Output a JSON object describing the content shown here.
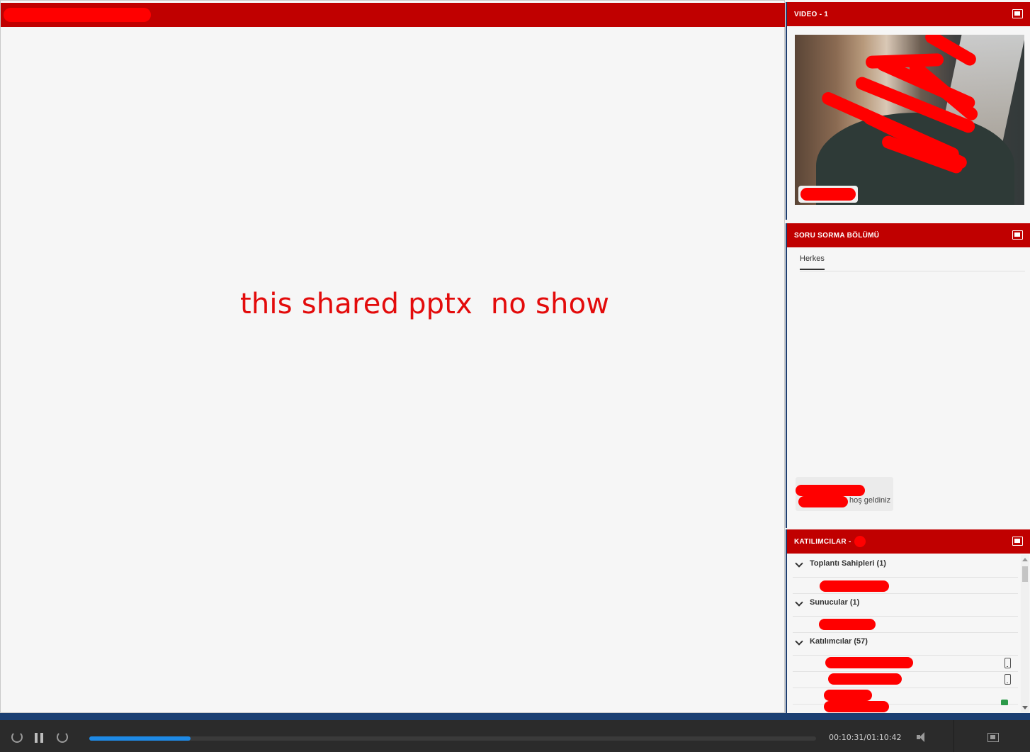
{
  "share_pod": {
    "message": "this shared pptx  no show"
  },
  "video_pod": {
    "title": "VIDEO - 1",
    "maximize_icon": "maximize-icon"
  },
  "qa_pod": {
    "title": "SORU SORMA BÖLÜMÜ",
    "tab_label": "Herkes",
    "message_text": "hoş geldiniz"
  },
  "attendees_pod": {
    "title": "KATILIMCILAR -",
    "groups": [
      {
        "label": "Toplantı Sahipleri (1)"
      },
      {
        "label": "Sunucular (1)"
      },
      {
        "label": "Katılımcılar (57)"
      }
    ]
  },
  "playback": {
    "time": "00:10:31/01:10:42",
    "progress": 0.139,
    "icons": [
      "rewind-icon",
      "pause-icon",
      "forward-icon",
      "volume-icon",
      "fullscreen-icon"
    ]
  },
  "colors": {
    "pod_header": "#c00000",
    "redaction": "#ff0000",
    "progress": "#1e8ae6",
    "accent_border": "#1b3f72"
  }
}
